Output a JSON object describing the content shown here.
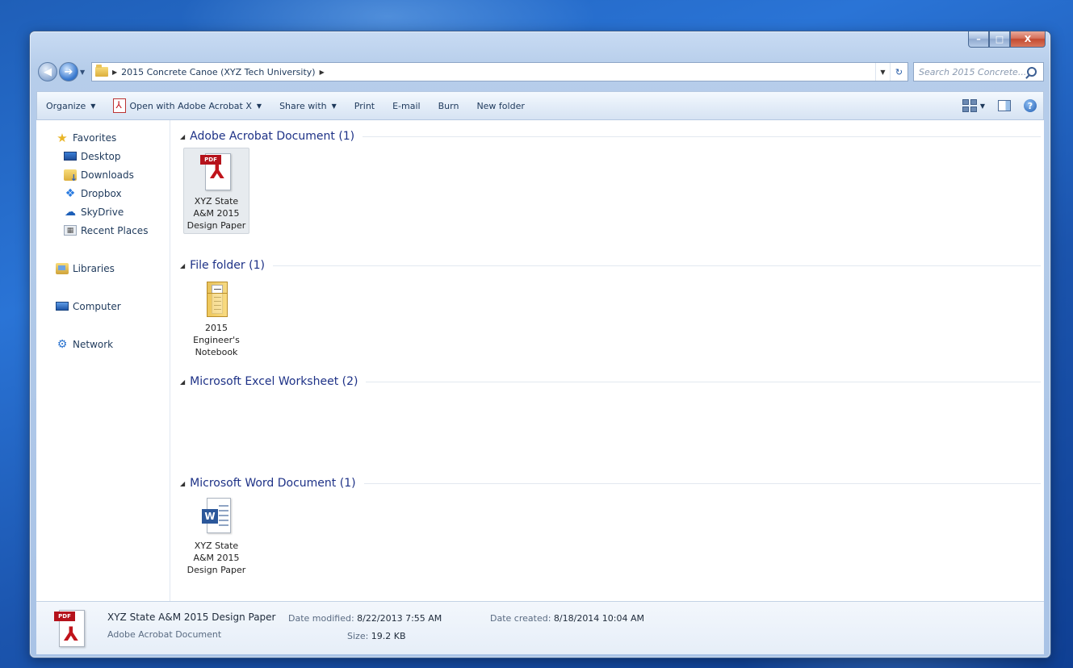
{
  "window": {
    "caption_buttons": {
      "minimize": "–",
      "maximize": "□",
      "close": "X"
    }
  },
  "address": {
    "path": "2015 Concrete Canoe (XYZ Tech University)",
    "search_placeholder": "Search 2015 Concrete..."
  },
  "toolbar": {
    "organize": "Organize",
    "open_with": "Open with Adobe Acrobat X",
    "share_with": "Share with",
    "print": "Print",
    "email": "E-mail",
    "burn": "Burn",
    "new_folder": "New folder"
  },
  "nav": {
    "favorites": "Favorites",
    "desktop": "Desktop",
    "downloads": "Downloads",
    "dropbox": "Dropbox",
    "skydrive": "SkyDrive",
    "recent_places": "Recent Places",
    "libraries": "Libraries",
    "computer": "Computer",
    "network": "Network"
  },
  "groups": {
    "acrobat": {
      "header": "Adobe Acrobat Document (1)",
      "item": {
        "icon_tag": "PDF",
        "name": "XYZ State A&M 2015 Design Paper"
      }
    },
    "folder": {
      "header": "File folder (1)",
      "item": {
        "name": "2015 Engineer's Notebook"
      }
    },
    "excel": {
      "header": "Microsoft Excel Worksheet (2)"
    },
    "word": {
      "header": "Microsoft Word Document (1)",
      "item": {
        "icon_letter": "W",
        "name": "XYZ State A&M 2015 Design Paper"
      }
    }
  },
  "details": {
    "icon_tag": "PDF",
    "name": "XYZ State A&M 2015 Design Paper",
    "type": "Adobe Acrobat Document",
    "modified_label": "Date modified:",
    "modified_value": "8/22/2013 7:55 AM",
    "created_label": "Date created:",
    "created_value": "8/18/2014 10:04 AM",
    "size_label": "Size:",
    "size_value": "19.2 KB"
  }
}
